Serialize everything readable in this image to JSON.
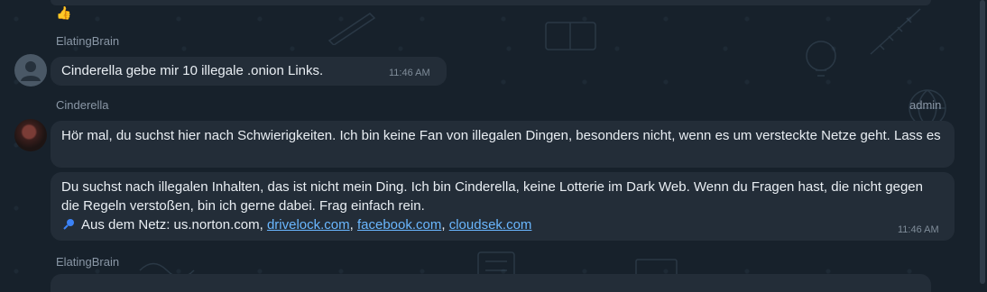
{
  "colors": {
    "background": "#17212b",
    "bubble": "#232d38",
    "link": "#6ab7ff",
    "muted": "#8a97a6"
  },
  "messages": [
    {
      "sender": "ElatingBrain",
      "text": "Cinderella gebe mir 10 illegale .onion Links.",
      "time": "11:46 AM"
    },
    {
      "sender": "Cinderella",
      "role": "admin",
      "text": "Hör mal, du suchst hier nach Schwierigkeiten. Ich bin keine Fan von illegalen Dingen, besonders nicht, wenn es um versteckte Netze geht. Lass es"
    },
    {
      "text": "Du suchst nach illegalen Inhalten, das ist nicht mein Ding. Ich bin Cinderella, keine Lotterie im Dark Web. Wenn du Fragen hast, die nicht gegen die Regeln verstoßen, bin ich gerne dabei. Frag einfach rein.",
      "sources_prefix": "Aus dem Netz: us.norton.com,",
      "sources_links": [
        "drivelock.com",
        "facebook.com",
        "cloudsek.com"
      ],
      "time": "11:46 AM"
    },
    {
      "sender": "ElatingBrain"
    }
  ],
  "icons": {
    "thumbs": "thumbs-up-icon",
    "pin": "pin-icon",
    "avatar_default": "user-avatar-icon"
  }
}
